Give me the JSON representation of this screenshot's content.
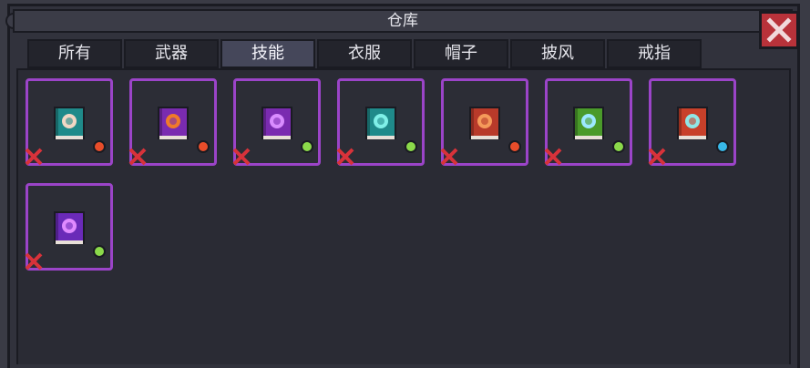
{
  "window": {
    "title": "仓库"
  },
  "tabs": [
    {
      "label": "所有",
      "active": false
    },
    {
      "label": "武器",
      "active": false
    },
    {
      "label": "技能",
      "active": true
    },
    {
      "label": "衣服",
      "active": false
    },
    {
      "label": "帽子",
      "active": false
    },
    {
      "label": "披风",
      "active": false
    },
    {
      "label": "戒指",
      "active": false
    }
  ],
  "items": [
    {
      "icon": "arch-skill-book-icon",
      "book_color": "#1f8a8a",
      "symbol_color": "#f2d7c4",
      "gem_color": "#e84d2a"
    },
    {
      "icon": "fire-face-skill-book-icon",
      "book_color": "#7a2bb0",
      "symbol_color": "#f07a2a",
      "gem_color": "#e84d2a"
    },
    {
      "icon": "purple-orb-skill-book-icon",
      "book_color": "#7a2bb0",
      "symbol_color": "#d98cff",
      "gem_color": "#8bd94a"
    },
    {
      "icon": "teal-flower-skill-book-icon",
      "book_color": "#1f8a8a",
      "symbol_color": "#7ff0e8",
      "gem_color": "#8bd94a"
    },
    {
      "icon": "red-swirl-skill-book-icon",
      "book_color": "#b83a2a",
      "symbol_color": "#f59a5a",
      "gem_color": "#e84d2a"
    },
    {
      "icon": "green-crystal-skill-book-icon",
      "book_color": "#4a9a2a",
      "symbol_color": "#9de8ff",
      "gem_color": "#8bd94a"
    },
    {
      "icon": "cyan-claw-skill-book-icon",
      "book_color": "#c8402a",
      "symbol_color": "#8fe6e6",
      "gem_color": "#38b8e8"
    },
    {
      "icon": "purple-sparkle-skill-book-icon",
      "book_color": "#6a2ab8",
      "symbol_color": "#e08aff",
      "gem_color": "#8bd94a"
    }
  ],
  "colors": {
    "slot_border": "#9b44c8",
    "remove_mark": "#d8323a",
    "close_button": "#b8323a"
  }
}
